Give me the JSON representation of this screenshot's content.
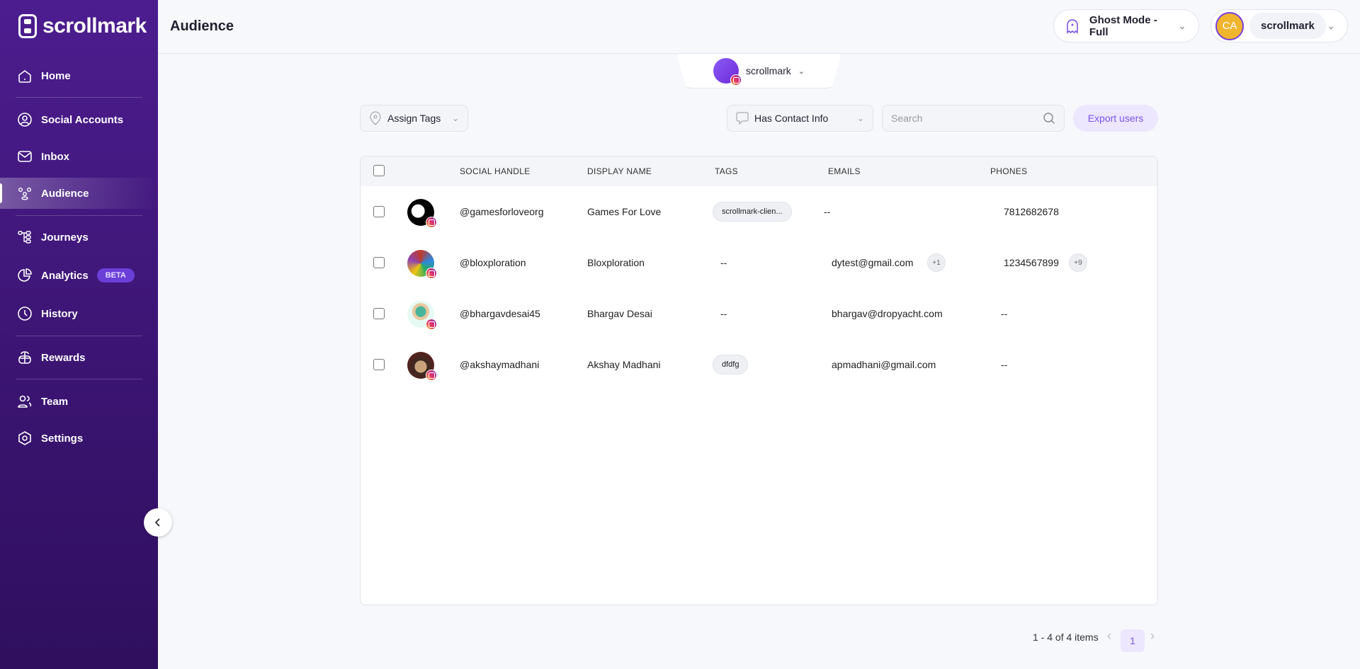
{
  "brand": "scrollmark",
  "sidebar": {
    "items": [
      {
        "label": "Home",
        "icon": "home-icon"
      },
      {
        "label": "Social Accounts",
        "icon": "user-circle-icon"
      },
      {
        "label": "Inbox",
        "icon": "inbox-icon"
      },
      {
        "label": "Audience",
        "icon": "audience-icon",
        "active": true
      },
      {
        "label": "Journeys",
        "icon": "journeys-icon"
      },
      {
        "label": "Analytics",
        "icon": "pie-chart-icon",
        "badge": "BETA"
      },
      {
        "label": "History",
        "icon": "clock-icon"
      },
      {
        "label": "Rewards",
        "icon": "gift-icon"
      },
      {
        "label": "Team",
        "icon": "team-icon"
      },
      {
        "label": "Settings",
        "icon": "settings-icon"
      }
    ]
  },
  "header": {
    "title": "Audience",
    "ghost_mode": "Ghost Mode - Full",
    "user_initials": "CA",
    "user_name": "scrollmark"
  },
  "account_selector": {
    "name": "scrollmark"
  },
  "toolbar": {
    "assign_tags": "Assign Tags",
    "filter": "Has Contact Info",
    "search_placeholder": "Search",
    "export": "Export users"
  },
  "table": {
    "columns": [
      "SOCIAL HANDLE",
      "DISPLAY NAME",
      "TAGS",
      "EMAILS",
      "PHONES"
    ],
    "rows": [
      {
        "handle": "@gamesforloveorg",
        "name": "Games For Love",
        "tag": "scrollmark-clien...",
        "email": "--",
        "email_more": "",
        "phone": "7812682678",
        "phone_more": ""
      },
      {
        "handle": "@bloxploration",
        "name": "Bloxploration",
        "tag": "--",
        "email": "dytest@gmail.com",
        "email_more": "+1",
        "phone": "1234567899",
        "phone_more": "+9"
      },
      {
        "handle": "@bhargavdesai45",
        "name": "Bhargav Desai",
        "tag": "--",
        "email": "bhargav@dropyacht.com",
        "email_more": "",
        "phone": "--",
        "phone_more": ""
      },
      {
        "handle": "@akshaymadhani",
        "name": "Akshay Madhani",
        "tag": "dfdfg",
        "email": "apmadhani@gmail.com",
        "email_more": "",
        "phone": "--",
        "phone_more": ""
      }
    ]
  },
  "pagination": {
    "summary": "1 - 4 of 4 items",
    "current_page": "1",
    "prev": "‹",
    "next": "›"
  }
}
